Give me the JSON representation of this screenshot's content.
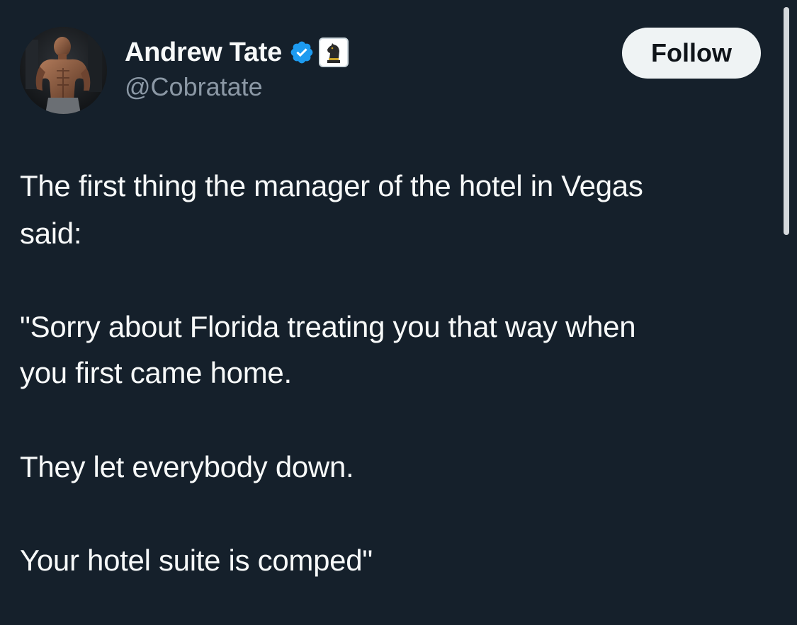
{
  "author": {
    "display_name": "Andrew Tate",
    "handle": "@Cobratate",
    "verified_badge_icon": "verified-check-icon",
    "affiliate_badge_icon": "chess-knight-icon"
  },
  "follow_button": {
    "label": "Follow"
  },
  "tweet": {
    "lines": [
      "The first thing the manager of the hotel in Vegas",
      "said:",
      "\"Sorry about Florida treating you that way when",
      "you first came home.",
      "They let everybody down.",
      "Your hotel suite is comped\""
    ]
  },
  "colors": {
    "background": "#15202b",
    "text": "#f7f9f9",
    "secondary_text": "#8b98a5",
    "verified_blue": "#1d9bf0",
    "button_bg": "#eff3f4",
    "button_text": "#0f1419"
  }
}
